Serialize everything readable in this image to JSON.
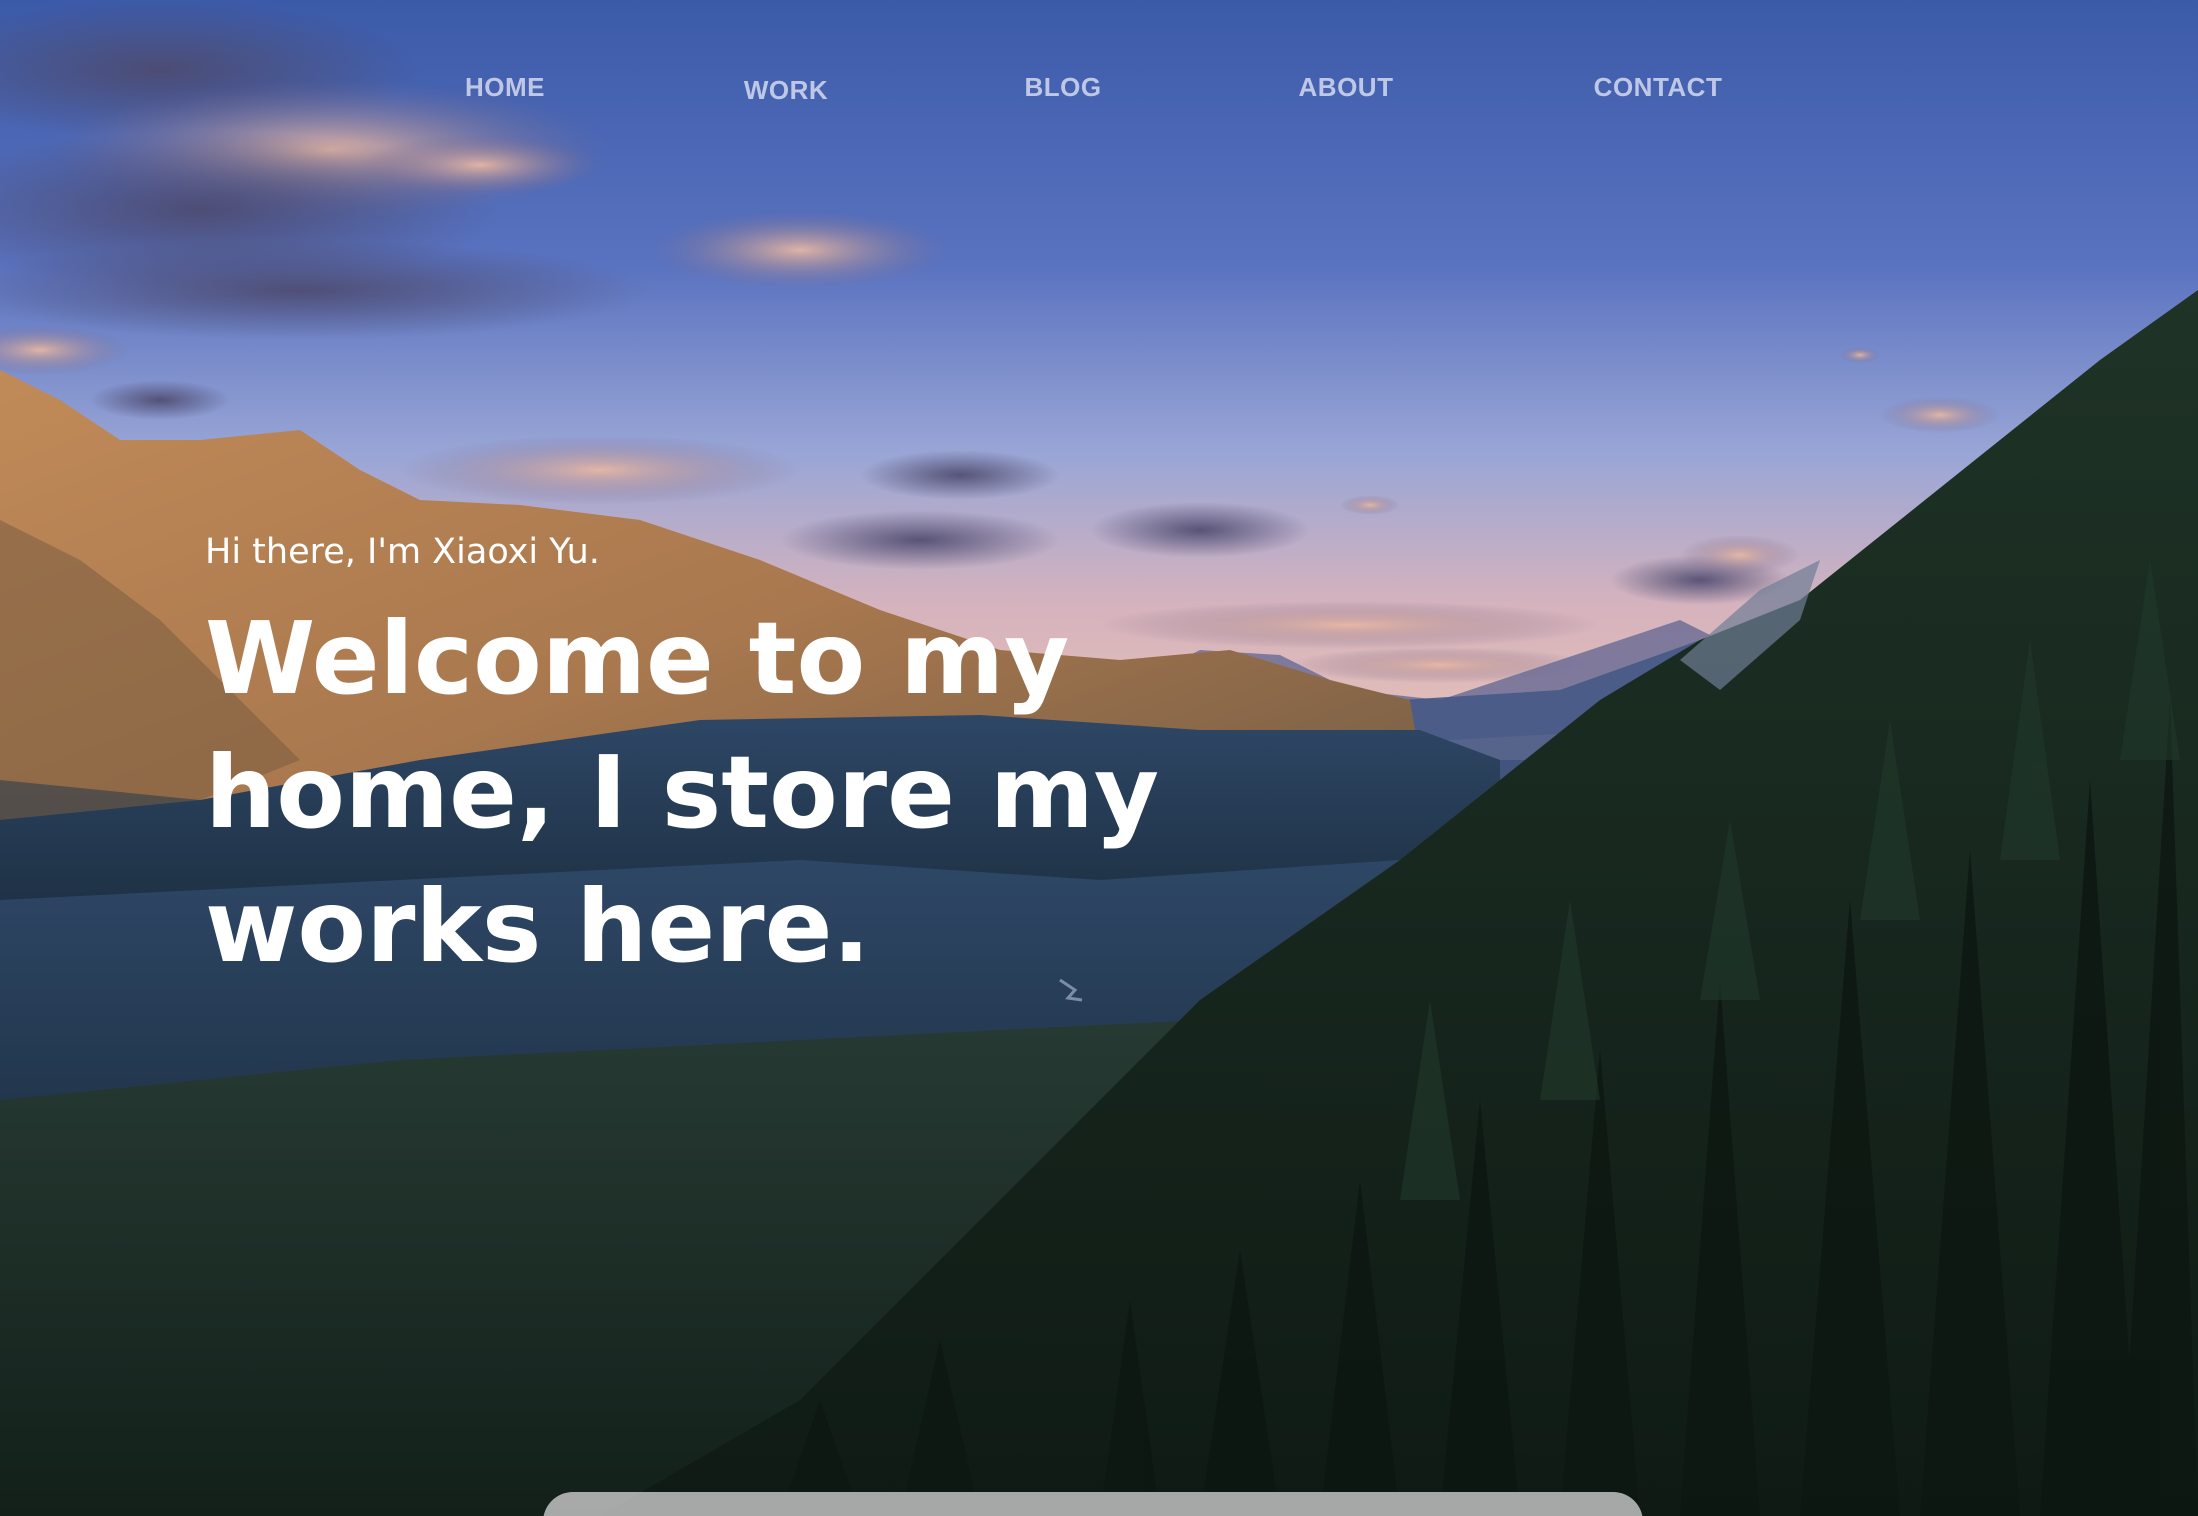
{
  "nav": {
    "items": [
      {
        "label": "HOME"
      },
      {
        "label": "WORK"
      },
      {
        "label": "BLOG"
      },
      {
        "label": "ABOUT"
      },
      {
        "label": "CONTACT"
      }
    ]
  },
  "hero": {
    "greeting": "Hi there, I'm Xiaoxi Yu.",
    "headline": "Welcome to my home, I store my works here."
  },
  "colors": {
    "sky_top": "#3d5fae",
    "sky_horizon": "#c9a9b6",
    "mountain_lit": "#b88454",
    "forest_dark": "#16241f",
    "nav_text": "#e1e4f5",
    "headline_text": "#ffffff"
  }
}
